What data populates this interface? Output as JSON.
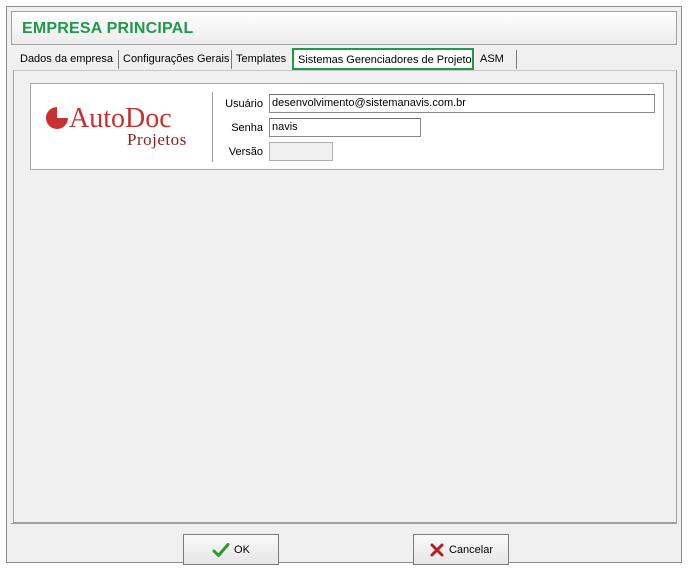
{
  "window": {
    "title": "EMPRESA PRINCIPAL"
  },
  "tabs": [
    {
      "label": "Dados da empresa"
    },
    {
      "label": "Configurações Gerais"
    },
    {
      "label": "Templates"
    },
    {
      "label": "Sistemas Gerenciadores de Projeto",
      "active": true
    },
    {
      "label": "ASM"
    }
  ],
  "logo": {
    "brand_main": "AutoDoc",
    "brand_sub": "Projetos",
    "colors": {
      "red": "#c8312f",
      "gray": "#4a4a4a",
      "sub": "#8b1e1e"
    }
  },
  "form": {
    "usuario": {
      "label": "Usuário",
      "value": "desenvolvimento@sistemanavis.com.br"
    },
    "senha": {
      "label": "Senha",
      "value": "navis"
    },
    "versao": {
      "label": "Versão",
      "value": ""
    }
  },
  "buttons": {
    "ok": {
      "label": "OK",
      "icon": "checkmark-icon"
    },
    "cancel": {
      "label": "Cancelar",
      "icon": "x-icon"
    }
  },
  "colors": {
    "accent": "#1f9a4a"
  }
}
